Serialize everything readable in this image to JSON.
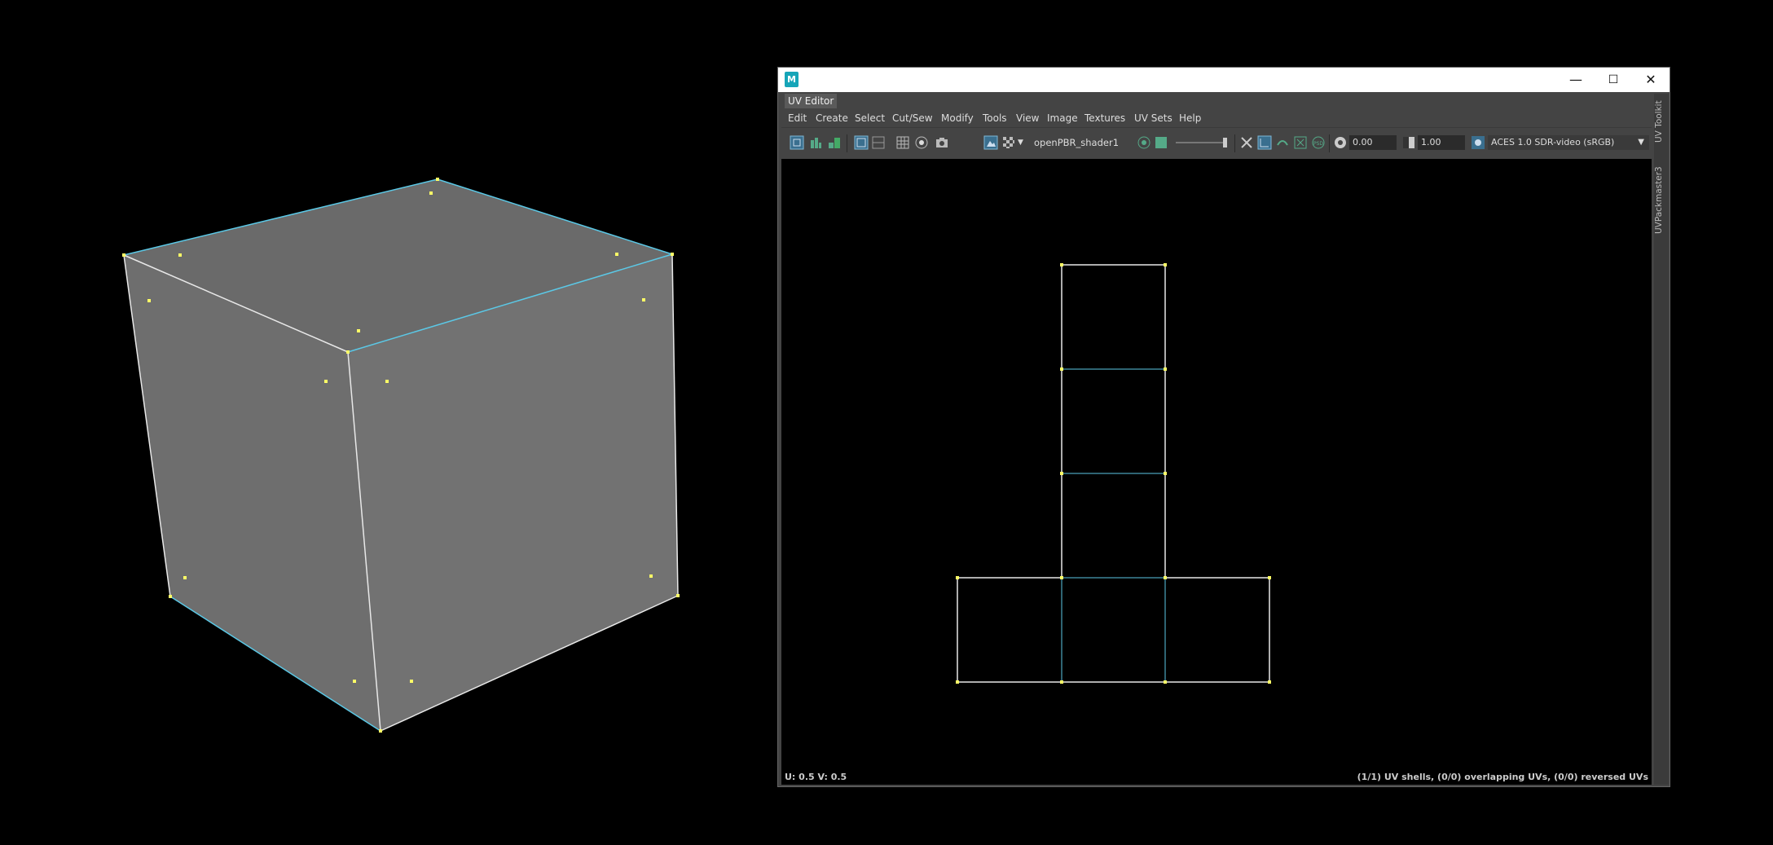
{
  "colors": {
    "edge_border": "#5bc8e6",
    "edge_normal": "#e8e8e8",
    "vertex": "#ffff66",
    "cube_face": "#6e6e6e"
  },
  "window": {
    "app_icon": "M",
    "minimize": "—",
    "maximize": "☐",
    "close": "✕",
    "panel_label": "UV Editor"
  },
  "menu": [
    "Edit",
    "Create",
    "Select",
    "Cut/Sew",
    "Modify",
    "Tools",
    "View",
    "Image",
    "Textures",
    "UV Sets",
    "Help"
  ],
  "toolbar": {
    "shader_name": "openPBR_shader1",
    "exposure": "0.00",
    "gamma": "1.00",
    "color_space": "ACES 1.0 SDR-video (sRGB)"
  },
  "status": {
    "uv_readout": "U:  0.5 V:  0.5",
    "shell_info": "(1/1) UV shells, (0/0) overlapping UVs, (0/0) reversed UVs"
  },
  "side_tabs": [
    "UV Toolkit",
    "UVPackmaster3"
  ]
}
